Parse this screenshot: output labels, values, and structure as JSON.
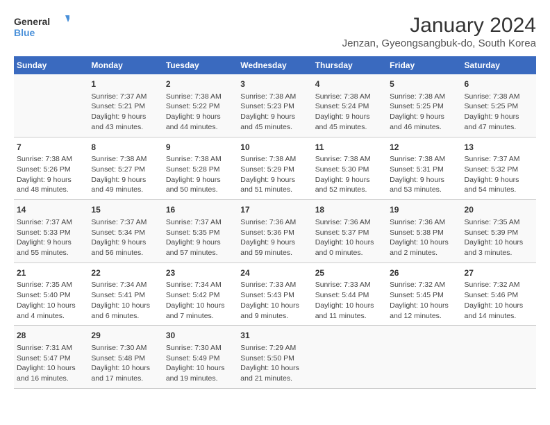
{
  "logo": {
    "text_general": "General",
    "text_blue": "Blue"
  },
  "title": "January 2024",
  "subtitle": "Jenzan, Gyeongsangbuk-do, South Korea",
  "header_days": [
    "Sunday",
    "Monday",
    "Tuesday",
    "Wednesday",
    "Thursday",
    "Friday",
    "Saturday"
  ],
  "weeks": [
    [
      {
        "day": "",
        "content": ""
      },
      {
        "day": "1",
        "content": "Sunrise: 7:37 AM\nSunset: 5:21 PM\nDaylight: 9 hours\nand 43 minutes."
      },
      {
        "day": "2",
        "content": "Sunrise: 7:38 AM\nSunset: 5:22 PM\nDaylight: 9 hours\nand 44 minutes."
      },
      {
        "day": "3",
        "content": "Sunrise: 7:38 AM\nSunset: 5:23 PM\nDaylight: 9 hours\nand 45 minutes."
      },
      {
        "day": "4",
        "content": "Sunrise: 7:38 AM\nSunset: 5:24 PM\nDaylight: 9 hours\nand 45 minutes."
      },
      {
        "day": "5",
        "content": "Sunrise: 7:38 AM\nSunset: 5:25 PM\nDaylight: 9 hours\nand 46 minutes."
      },
      {
        "day": "6",
        "content": "Sunrise: 7:38 AM\nSunset: 5:25 PM\nDaylight: 9 hours\nand 47 minutes."
      }
    ],
    [
      {
        "day": "7",
        "content": "Sunrise: 7:38 AM\nSunset: 5:26 PM\nDaylight: 9 hours\nand 48 minutes."
      },
      {
        "day": "8",
        "content": "Sunrise: 7:38 AM\nSunset: 5:27 PM\nDaylight: 9 hours\nand 49 minutes."
      },
      {
        "day": "9",
        "content": "Sunrise: 7:38 AM\nSunset: 5:28 PM\nDaylight: 9 hours\nand 50 minutes."
      },
      {
        "day": "10",
        "content": "Sunrise: 7:38 AM\nSunset: 5:29 PM\nDaylight: 9 hours\nand 51 minutes."
      },
      {
        "day": "11",
        "content": "Sunrise: 7:38 AM\nSunset: 5:30 PM\nDaylight: 9 hours\nand 52 minutes."
      },
      {
        "day": "12",
        "content": "Sunrise: 7:38 AM\nSunset: 5:31 PM\nDaylight: 9 hours\nand 53 minutes."
      },
      {
        "day": "13",
        "content": "Sunrise: 7:37 AM\nSunset: 5:32 PM\nDaylight: 9 hours\nand 54 minutes."
      }
    ],
    [
      {
        "day": "14",
        "content": "Sunrise: 7:37 AM\nSunset: 5:33 PM\nDaylight: 9 hours\nand 55 minutes."
      },
      {
        "day": "15",
        "content": "Sunrise: 7:37 AM\nSunset: 5:34 PM\nDaylight: 9 hours\nand 56 minutes."
      },
      {
        "day": "16",
        "content": "Sunrise: 7:37 AM\nSunset: 5:35 PM\nDaylight: 9 hours\nand 57 minutes."
      },
      {
        "day": "17",
        "content": "Sunrise: 7:36 AM\nSunset: 5:36 PM\nDaylight: 9 hours\nand 59 minutes."
      },
      {
        "day": "18",
        "content": "Sunrise: 7:36 AM\nSunset: 5:37 PM\nDaylight: 10 hours\nand 0 minutes."
      },
      {
        "day": "19",
        "content": "Sunrise: 7:36 AM\nSunset: 5:38 PM\nDaylight: 10 hours\nand 2 minutes."
      },
      {
        "day": "20",
        "content": "Sunrise: 7:35 AM\nSunset: 5:39 PM\nDaylight: 10 hours\nand 3 minutes."
      }
    ],
    [
      {
        "day": "21",
        "content": "Sunrise: 7:35 AM\nSunset: 5:40 PM\nDaylight: 10 hours\nand 4 minutes."
      },
      {
        "day": "22",
        "content": "Sunrise: 7:34 AM\nSunset: 5:41 PM\nDaylight: 10 hours\nand 6 minutes."
      },
      {
        "day": "23",
        "content": "Sunrise: 7:34 AM\nSunset: 5:42 PM\nDaylight: 10 hours\nand 7 minutes."
      },
      {
        "day": "24",
        "content": "Sunrise: 7:33 AM\nSunset: 5:43 PM\nDaylight: 10 hours\nand 9 minutes."
      },
      {
        "day": "25",
        "content": "Sunrise: 7:33 AM\nSunset: 5:44 PM\nDaylight: 10 hours\nand 11 minutes."
      },
      {
        "day": "26",
        "content": "Sunrise: 7:32 AM\nSunset: 5:45 PM\nDaylight: 10 hours\nand 12 minutes."
      },
      {
        "day": "27",
        "content": "Sunrise: 7:32 AM\nSunset: 5:46 PM\nDaylight: 10 hours\nand 14 minutes."
      }
    ],
    [
      {
        "day": "28",
        "content": "Sunrise: 7:31 AM\nSunset: 5:47 PM\nDaylight: 10 hours\nand 16 minutes."
      },
      {
        "day": "29",
        "content": "Sunrise: 7:30 AM\nSunset: 5:48 PM\nDaylight: 10 hours\nand 17 minutes."
      },
      {
        "day": "30",
        "content": "Sunrise: 7:30 AM\nSunset: 5:49 PM\nDaylight: 10 hours\nand 19 minutes."
      },
      {
        "day": "31",
        "content": "Sunrise: 7:29 AM\nSunset: 5:50 PM\nDaylight: 10 hours\nand 21 minutes."
      },
      {
        "day": "",
        "content": ""
      },
      {
        "day": "",
        "content": ""
      },
      {
        "day": "",
        "content": ""
      }
    ]
  ]
}
